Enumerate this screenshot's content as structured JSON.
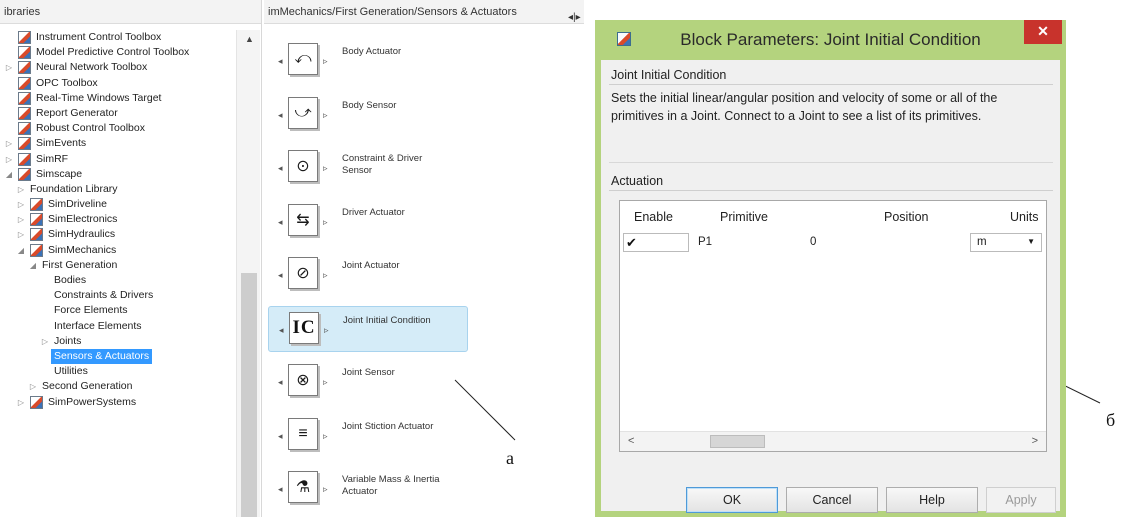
{
  "library_browser": {
    "header": "ibraries",
    "tree": [
      {
        "label": "Instrument Control Toolbox",
        "indent": 1,
        "icon": true,
        "twisty": ""
      },
      {
        "label": "Model Predictive Control Toolbox",
        "indent": 1,
        "icon": true,
        "twisty": ""
      },
      {
        "label": "Neural Network Toolbox",
        "indent": 1,
        "icon": true,
        "twisty": "▷"
      },
      {
        "label": "OPC Toolbox",
        "indent": 1,
        "icon": true,
        "twisty": ""
      },
      {
        "label": "Real-Time Windows Target",
        "indent": 1,
        "icon": true,
        "twisty": ""
      },
      {
        "label": "Report Generator",
        "indent": 1,
        "icon": true,
        "twisty": ""
      },
      {
        "label": "Robust Control Toolbox",
        "indent": 1,
        "icon": true,
        "twisty": ""
      },
      {
        "label": "SimEvents",
        "indent": 1,
        "icon": true,
        "twisty": "▷"
      },
      {
        "label": "SimRF",
        "indent": 1,
        "icon": true,
        "twisty": "▷"
      },
      {
        "label": "Simscape",
        "indent": 1,
        "icon": true,
        "twisty": "◢"
      },
      {
        "label": "Foundation Library",
        "indent": 2,
        "icon": false,
        "twisty": "▷"
      },
      {
        "label": "SimDriveline",
        "indent": 2,
        "icon": true,
        "twisty": "▷"
      },
      {
        "label": "SimElectronics",
        "indent": 2,
        "icon": true,
        "twisty": "▷"
      },
      {
        "label": "SimHydraulics",
        "indent": 2,
        "icon": true,
        "twisty": "▷"
      },
      {
        "label": "SimMechanics",
        "indent": 2,
        "icon": true,
        "twisty": "◢"
      },
      {
        "label": "First Generation",
        "indent": 3,
        "icon": false,
        "twisty": "◢"
      },
      {
        "label": "Bodies",
        "indent": 4,
        "icon": false,
        "twisty": ""
      },
      {
        "label": "Constraints & Drivers",
        "indent": 4,
        "icon": false,
        "twisty": ""
      },
      {
        "label": "Force  Elements",
        "indent": 4,
        "icon": false,
        "twisty": ""
      },
      {
        "label": "Interface  Elements",
        "indent": 4,
        "icon": false,
        "twisty": ""
      },
      {
        "label": "Joints",
        "indent": 4,
        "icon": false,
        "twisty": "▷"
      },
      {
        "label": "Sensors & Actuators",
        "indent": 4,
        "icon": false,
        "twisty": "",
        "selected": true
      },
      {
        "label": "Utilities",
        "indent": 4,
        "icon": false,
        "twisty": ""
      },
      {
        "label": "Second Generation",
        "indent": 3,
        "icon": false,
        "twisty": "▷"
      },
      {
        "label": "SimPowerSystems",
        "indent": 2,
        "icon": true,
        "twisty": "▷"
      }
    ]
  },
  "blocks_panel": {
    "path": "imMechanics/First Generation/Sensors & Actuators",
    "nav": "◂|▸",
    "blocks": [
      {
        "label": "Body Actuator",
        "glyph": "⤺"
      },
      {
        "label": "Body Sensor",
        "glyph": "⤻"
      },
      {
        "label": "Constraint & Driver  Sensor",
        "glyph": "⊙"
      },
      {
        "label": "Driver Actuator",
        "glyph": "⇆"
      },
      {
        "label": "Joint Actuator",
        "glyph": "⊘"
      },
      {
        "label": "Joint Initial Condition",
        "glyph": "IC"
      },
      {
        "label": "Joint Sensor",
        "glyph": "⊗"
      },
      {
        "label": "Joint Stiction Actuator",
        "glyph": "≡"
      },
      {
        "label": "Variable Mass & Inertia Actuator",
        "glyph": "⚗"
      }
    ]
  },
  "annotations": {
    "a": "а",
    "b": "б"
  },
  "dialog": {
    "title": "Block Parameters: Joint Initial Condition",
    "close": "✕",
    "block_type": "Joint Initial Condition",
    "description": "Sets the initial linear/angular position and velocity of some or all of the primitives in a Joint. Connect to a Joint to see a list of its primitives.",
    "section": "Actuation",
    "table": {
      "columns": [
        "Enable",
        "Primitive",
        "Position",
        "Units"
      ],
      "rows": [
        {
          "enable": "✔",
          "primitive": "P1",
          "position": "0",
          "units": "m"
        }
      ]
    },
    "buttons": {
      "ok": "OK",
      "cancel": "Cancel",
      "help": "Help",
      "apply": "Apply"
    }
  },
  "colors": {
    "title_bar": "#b4d37e",
    "selection": "#3399ff",
    "close": "#c8332c"
  }
}
